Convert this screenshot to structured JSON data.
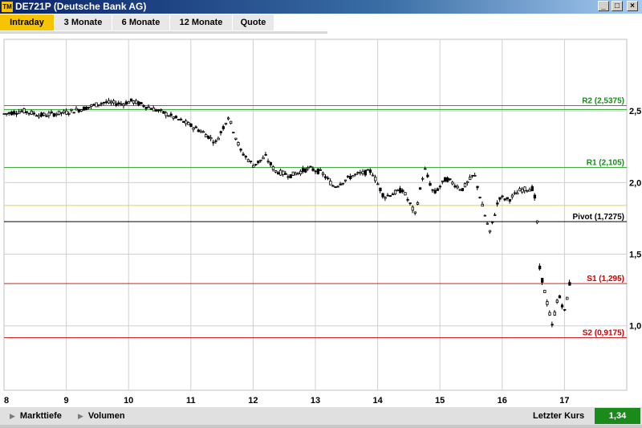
{
  "window": {
    "title": "DE721P (Deutsche Bank AG)",
    "icon_label": "TM",
    "buttons": [
      "_",
      "□",
      "×"
    ]
  },
  "tabs": [
    {
      "label": "Intraday",
      "active": true
    },
    {
      "label": "3 Monate",
      "active": false
    },
    {
      "label": "6 Monate",
      "active": false
    },
    {
      "label": "12 Monate",
      "active": false
    },
    {
      "label": "Quote",
      "active": false
    }
  ],
  "bottom": {
    "markttiefe": "Markttiefe",
    "volumen": "Volumen",
    "letzter_kurs_label": "Letzter Kurs",
    "letzter_kurs_value": "1,34",
    "value_color": "#1a8a1a"
  },
  "chart_data": {
    "type": "candlestick",
    "x_ticks": [
      "8",
      "9",
      "10",
      "11",
      "12",
      "13",
      "14",
      "15",
      "16",
      "17"
    ],
    "y_ticks": [
      {
        "value": 2.5,
        "label": "2,5"
      },
      {
        "value": 2.0,
        "label": "2,0"
      },
      {
        "value": 1.5,
        "label": "1,5"
      },
      {
        "value": 1.0,
        "label": "1,0"
      }
    ],
    "ylim": [
      0.55,
      3.0
    ],
    "xlim": [
      8.0,
      18.0
    ],
    "grid": true,
    "levels": [
      {
        "name": "R2",
        "label": "R2 (2,5375)",
        "value": 2.5375,
        "color": "#2aa02a",
        "text_color": "#1a8a1a"
      },
      {
        "name": "R1",
        "label": "R1 (2,105)",
        "value": 2.105,
        "color": "#2aa02a",
        "text_color": "#1a8a1a"
      },
      {
        "name": "Pivot",
        "label": "Pivot (1,7275)",
        "value": 1.7275,
        "color": "#000000",
        "text_color": "#000000"
      },
      {
        "name": "S1",
        "label": "S1 (1,295)",
        "value": 1.295,
        "color": "#d02020",
        "text_color": "#cc0000"
      },
      {
        "name": "S2",
        "label": "S2 (0,9175)",
        "value": 0.9175,
        "color": "#d02020",
        "text_color": "#cc0000"
      }
    ],
    "extra_lines": [
      {
        "value": 2.51,
        "color": "#2aa02a"
      },
      {
        "value": 1.84,
        "color": "#e8d040"
      }
    ],
    "price_path": [
      [
        8.0,
        2.48
      ],
      [
        8.3,
        2.5
      ],
      [
        8.6,
        2.47
      ],
      [
        9.0,
        2.49
      ],
      [
        9.3,
        2.52
      ],
      [
        9.6,
        2.56
      ],
      [
        9.9,
        2.55
      ],
      [
        10.05,
        2.57
      ],
      [
        10.3,
        2.53
      ],
      [
        10.6,
        2.48
      ],
      [
        10.9,
        2.42
      ],
      [
        11.2,
        2.35
      ],
      [
        11.4,
        2.28
      ],
      [
        11.6,
        2.46
      ],
      [
        11.8,
        2.22
      ],
      [
        12.0,
        2.12
      ],
      [
        12.2,
        2.18
      ],
      [
        12.35,
        2.08
      ],
      [
        12.6,
        2.05
      ],
      [
        12.9,
        2.1
      ],
      [
        13.1,
        2.07
      ],
      [
        13.3,
        1.97
      ],
      [
        13.6,
        2.05
      ],
      [
        13.9,
        2.08
      ],
      [
        14.1,
        1.9
      ],
      [
        14.4,
        1.95
      ],
      [
        14.6,
        1.78
      ],
      [
        14.75,
        2.1
      ],
      [
        14.9,
        1.92
      ],
      [
        15.1,
        2.03
      ],
      [
        15.35,
        1.95
      ],
      [
        15.55,
        2.06
      ],
      [
        15.7,
        1.8
      ],
      [
        15.8,
        1.65
      ],
      [
        15.95,
        1.9
      ],
      [
        16.1,
        1.88
      ],
      [
        16.3,
        1.95
      ],
      [
        16.5,
        1.96
      ],
      [
        16.55,
        1.8
      ],
      [
        16.6,
        1.4
      ],
      [
        16.7,
        1.2
      ],
      [
        16.8,
        1.0
      ],
      [
        16.9,
        1.22
      ],
      [
        17.0,
        1.1
      ],
      [
        17.1,
        1.34
      ]
    ]
  }
}
